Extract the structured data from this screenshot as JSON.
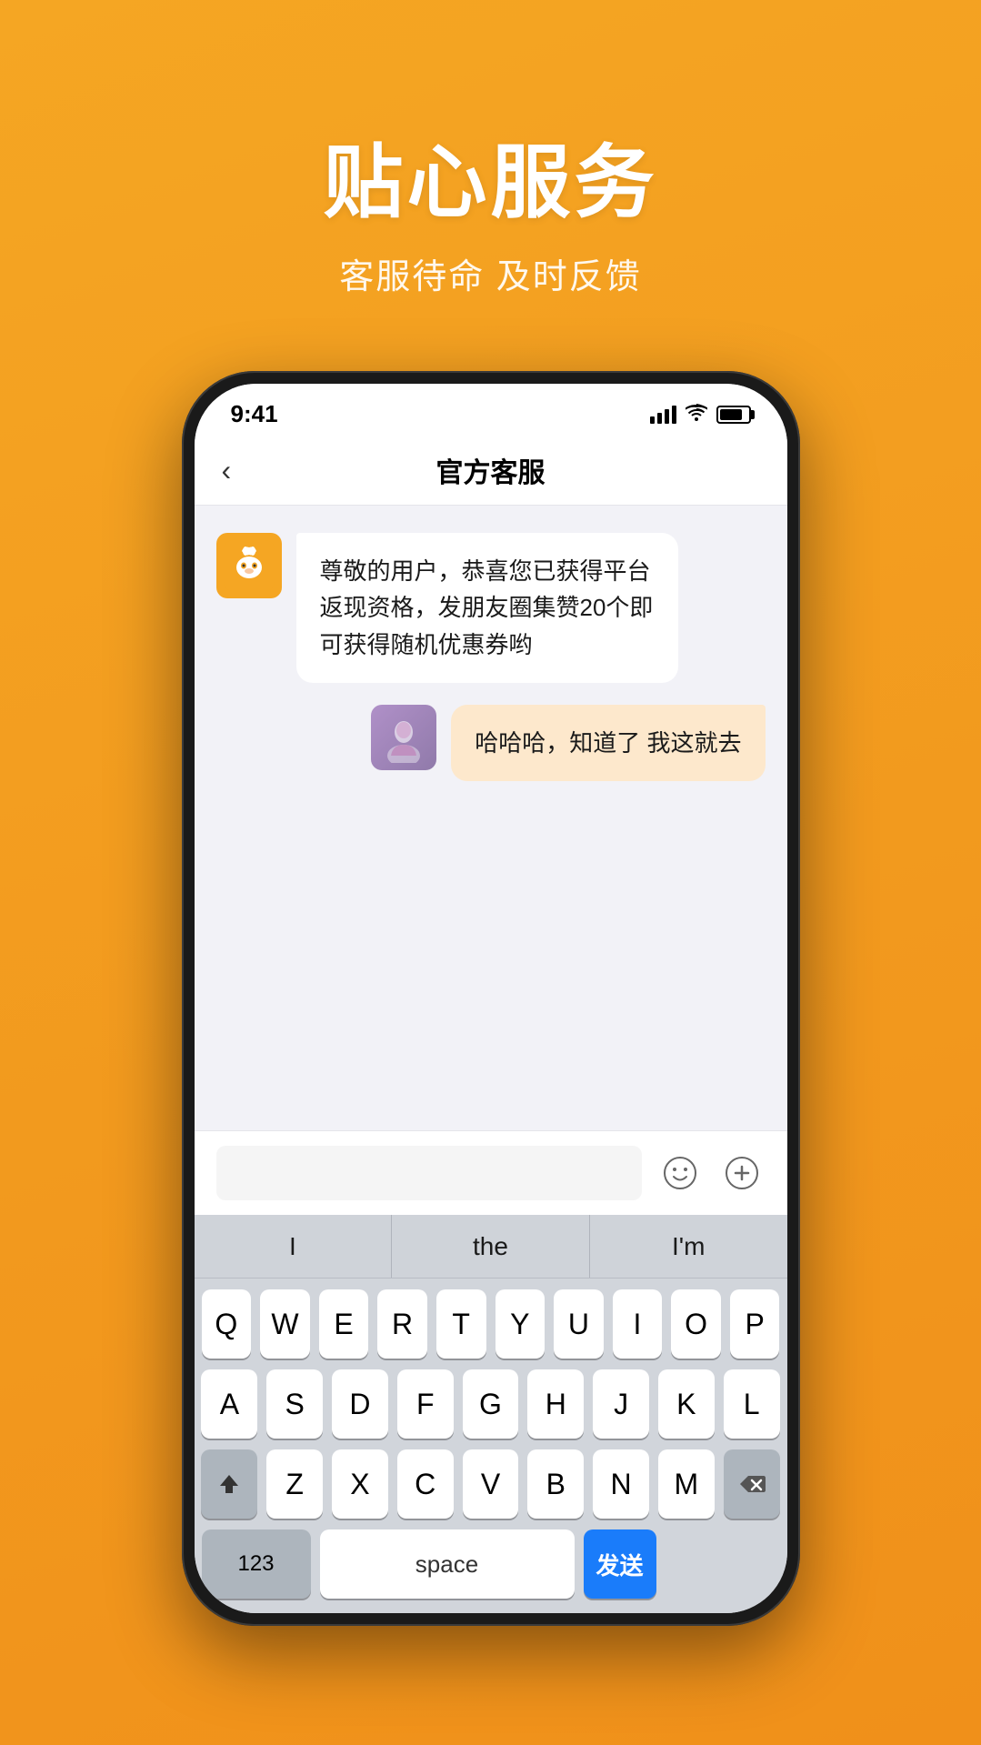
{
  "hero": {
    "title": "贴心服务",
    "subtitle": "客服待命 及时反馈"
  },
  "statusBar": {
    "time": "9:41",
    "batteryLevel": "80%"
  },
  "navBar": {
    "backLabel": "‹",
    "title": "官方客服"
  },
  "chat": {
    "messages": [
      {
        "id": 1,
        "side": "left",
        "text": "尊敬的用户，恭喜您已获得平台返现资格，发朋友圈集赞20个即可获得随机优惠券哟",
        "avatarType": "bot"
      },
      {
        "id": 2,
        "side": "right",
        "text": "哈哈哈，知道了 我这就去",
        "avatarType": "user"
      }
    ]
  },
  "inputArea": {
    "placeholder": "",
    "emojiBtn": "☺",
    "plusBtn": "⊕"
  },
  "keyboard": {
    "suggestions": [
      "I",
      "the",
      "I'm"
    ],
    "rows": [
      [
        "Q",
        "W",
        "E",
        "R",
        "T",
        "Y",
        "U",
        "I",
        "O",
        "P"
      ],
      [
        "A",
        "S",
        "D",
        "F",
        "G",
        "H",
        "J",
        "K",
        "L"
      ],
      [
        "↑",
        "Z",
        "X",
        "C",
        "V",
        "B",
        "N",
        "M",
        "⌫"
      ]
    ],
    "bottomRow": {
      "numbers": "123",
      "space": "space",
      "send": "发送"
    }
  }
}
